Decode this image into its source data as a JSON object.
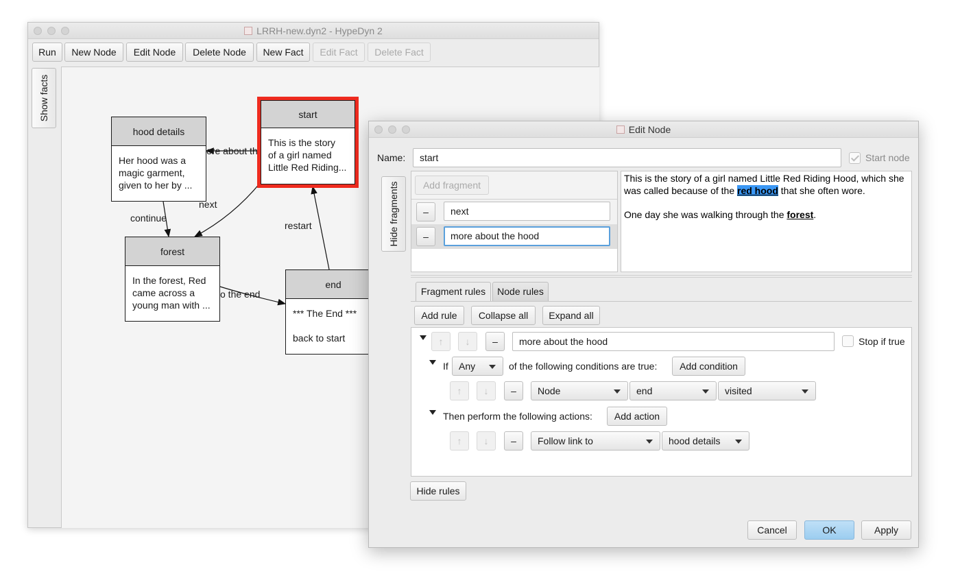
{
  "main_window": {
    "title": "LRRH-new.dyn2 - HypeDyn 2",
    "toolbar": [
      {
        "label": "Run",
        "enabled": true
      },
      {
        "label": "New Node",
        "enabled": true
      },
      {
        "label": "Edit Node",
        "enabled": true
      },
      {
        "label": "Delete Node",
        "enabled": true
      },
      {
        "label": "New Fact",
        "enabled": true
      },
      {
        "label": "Edit Fact",
        "enabled": false
      },
      {
        "label": "Delete Fact",
        "enabled": false
      }
    ],
    "side_tab": "Show facts"
  },
  "graph": {
    "nodes": [
      {
        "id": "hood-details",
        "title": "hood details",
        "text": "Her hood was a\nmagic garment,\ngiven to her by ..."
      },
      {
        "id": "start",
        "title": "start",
        "text": "This is the story\nof a girl named\nLittle Red Riding...",
        "selected": true
      },
      {
        "id": "forest",
        "title": "forest",
        "text": "In the forest, Red\ncame across a\nyoung man with ..."
      },
      {
        "id": "end",
        "title": "end",
        "text": "*** The End ***\n\nback to start"
      }
    ],
    "edge_labels": {
      "more_about": "ore about th",
      "next": "next",
      "continue": "continue",
      "restart": "restart",
      "to_the_end": "o the end"
    },
    "selected_color": "#ee2b1f"
  },
  "dialog": {
    "title": "Edit Node",
    "name_label": "Name:",
    "name_value": "start",
    "start_node_label": "Start node",
    "start_node_checked": true,
    "hide_fragments_tab": "Hide fragments",
    "add_fragment_label": "Add fragment",
    "fragments": [
      {
        "remove": "–",
        "value": "next"
      },
      {
        "remove": "–",
        "value": "more about the hood",
        "focused": true
      }
    ],
    "text": {
      "p1_a": "This is the story of a girl named Little Red Riding Hood, which she was called because of the ",
      "p1_link": "red hood",
      "p1_b": " that she often wore.",
      "p2_a": "One day she was walking through the ",
      "p2_link": "forest",
      "p2_b": "."
    },
    "tabs": [
      {
        "label": "Fragment rules",
        "active": true
      },
      {
        "label": "Node rules",
        "active": false
      }
    ],
    "rule_toolbar": [
      "Add rule",
      "Collapse all",
      "Expand all"
    ],
    "rule": {
      "up": "↑",
      "down": "↓",
      "remove": "–",
      "name": "more about the hood",
      "stop_if_true_label": "Stop if true",
      "if_label": "If",
      "if_mode": "Any",
      "conditions_label": "of the following conditions are true:",
      "add_condition": "Add condition",
      "condition": {
        "type": "Node",
        "target": "end",
        "state": "visited"
      },
      "actions_label": "Then perform the following actions:",
      "add_action": "Add action",
      "action": {
        "type": "Follow link to",
        "target": "hood details"
      }
    },
    "hide_rules": "Hide rules",
    "footer": {
      "cancel": "Cancel",
      "ok": "OK",
      "apply": "Apply"
    }
  }
}
